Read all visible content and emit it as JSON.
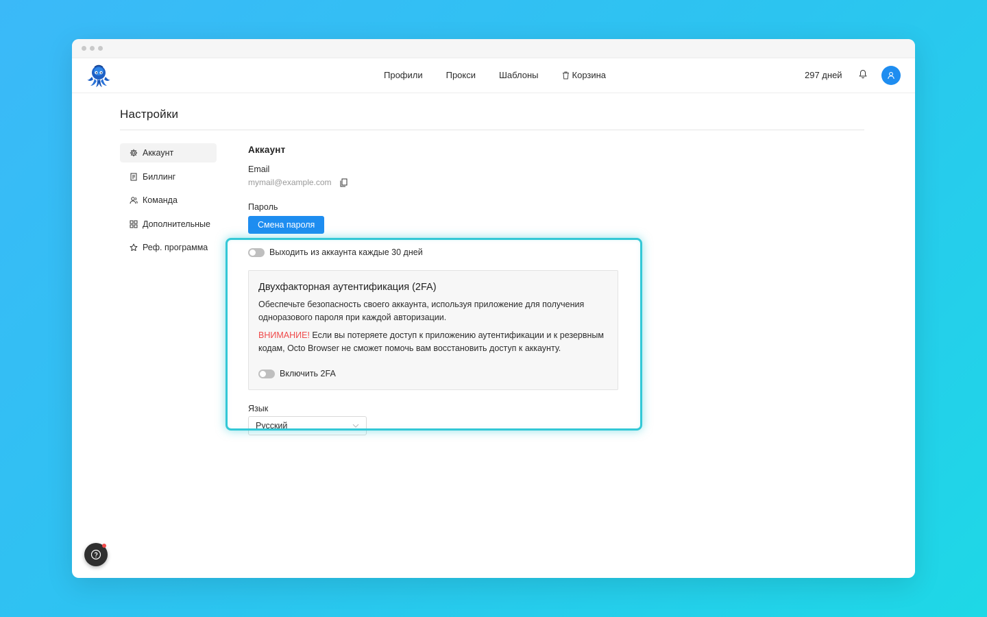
{
  "nav": {
    "links": [
      {
        "label": "Профили"
      },
      {
        "label": "Прокси"
      },
      {
        "label": "Шаблоны"
      },
      {
        "label": "Корзина",
        "icon": "trash-icon"
      }
    ],
    "days_left": "297 дней"
  },
  "page": {
    "title": "Настройки"
  },
  "sidebar": {
    "items": [
      {
        "label": "Аккаунт",
        "icon": "gear-icon",
        "active": true
      },
      {
        "label": "Биллинг",
        "icon": "receipt-icon"
      },
      {
        "label": "Команда",
        "icon": "team-icon"
      },
      {
        "label": "Дополнительные",
        "icon": "grid-icon"
      },
      {
        "label": "Реф. программа",
        "icon": "star-icon"
      }
    ]
  },
  "account": {
    "section_title": "Аккаунт",
    "email_label": "Email",
    "email_value": "mymail@example.com",
    "password_label": "Пароль",
    "change_password_button": "Смена пароля",
    "logout_toggle_label": "Выходить из аккаунта каждые 30 дней",
    "twofa": {
      "title": "Двухфакторная аутентификация (2FA)",
      "description": "Обеспечьте безопасность своего аккаунта, используя приложение для получения одноразового пароля при каждой авторизации.",
      "warning_label": "ВНИМАНИЕ!",
      "warning_text": " Если вы потеряете доступ к приложению аутентификации и к резервным кодам, Octo Browser не сможет помочь вам восстановить доступ к аккаунту.",
      "enable_toggle_label": "Включить 2FA"
    },
    "language_label": "Язык",
    "language_value": "Русский"
  },
  "colors": {
    "accent": "#1e8df0",
    "highlight": "#33c8d6",
    "warning": "#ef4a4a"
  }
}
